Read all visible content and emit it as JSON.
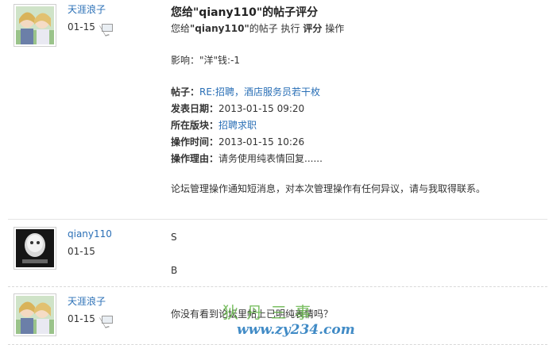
{
  "messages": [
    {
      "user": "天涯浪子",
      "date": "01-15",
      "title": "您给\"qiany110\"的帖子评分",
      "subtitle_prefix": "您给",
      "subtitle_user": "\"qiany110\"",
      "subtitle_mid": "的帖子 执行 ",
      "subtitle_action": "评分",
      "subtitle_end": " 操作",
      "influence": "影响：\"洋\"钱:-1",
      "post_label": "帖子：",
      "post_link": "RE:招聘，酒店服务员若干枚",
      "date_label": "发表日期：",
      "date_value": "2013-01-15 09:20",
      "board_label": "所在版块：",
      "board_value": "招聘求职",
      "optime_label": "操作时间：",
      "optime_value": "2013-01-15 10:26",
      "reason_label": "操作理由：",
      "reason_value": "请务使用纯表情回复......",
      "notice": "论坛管理操作通知短消息，对本次管理操作有任何异议，请与我取得联系。"
    },
    {
      "user": "qiany110",
      "date": "01-15",
      "line1": "S",
      "line2": "B"
    },
    {
      "user": "天涯浪子",
      "date": "01-15",
      "text": "你没有看到论坛里帖上已明纯表情吗？"
    }
  ],
  "watermark": {
    "top": "狄 丹 三 事",
    "bottom": "www.zy234.com"
  },
  "colors": {
    "link": "#2a6fb6",
    "text": "#333333",
    "divider": "#d8d8d8"
  },
  "icons": [
    "mail-icon"
  ]
}
